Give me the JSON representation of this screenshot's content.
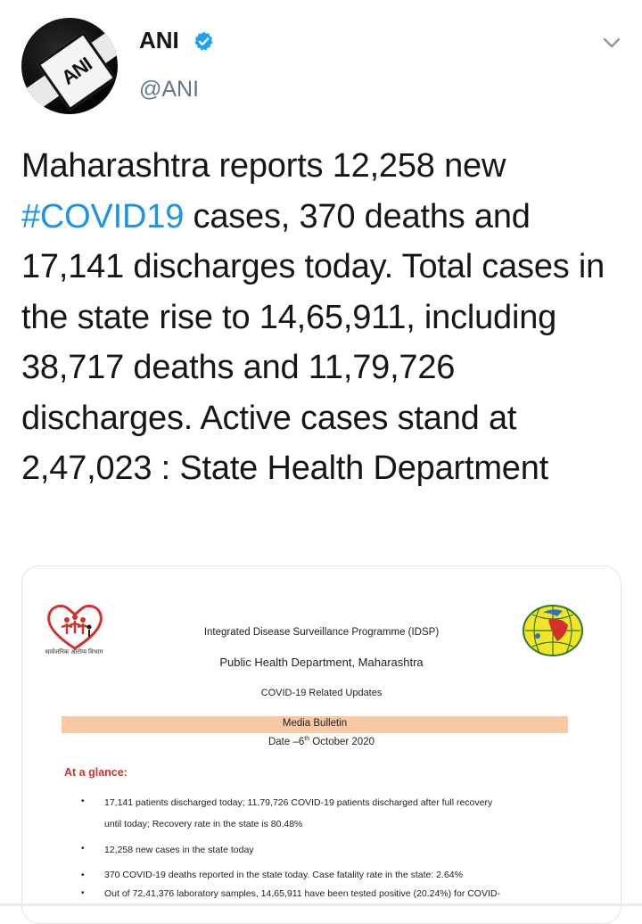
{
  "tweet": {
    "display_name": "ANI",
    "handle": "@ANI",
    "avatar_text": "ANI",
    "text_before_hashtag": "Maharashtra reports 12,258 new ",
    "hashtag": "#COVID19",
    "text_after_hashtag": " cases, 370 deaths and 17,141 discharges today. Total cases in the state rise to 14,65,911, including 38,717 deaths and 11,79,726 discharges. Active cases stand at 2,47,023 : State Health Department"
  },
  "icons": {
    "verified": "verified-badge-icon",
    "menu": "chevron-down-icon"
  },
  "colors": {
    "hashtag": "#1b95e0",
    "verified": "#1da1f2",
    "handle": "#657786",
    "bulletin_bar": "#f8c9a4",
    "at_a_glance": "#d2302c"
  },
  "document": {
    "line1": "Integrated Disease Surveillance Programme (IDSP)",
    "line2": "Public Health Department, Maharashtra",
    "line3": "COVID-19 Related Updates",
    "bulletin": "Media Bulletin",
    "date_prefix": "Date –6",
    "date_sup": "th",
    "date_suffix": " October 2020",
    "left_logo_caption": "सार्वजनिक आरोग्य विभाग",
    "at_a_glance": "At a glance:",
    "bullets": [
      "17,141 patients discharged today; 11,79,726 COVID-19 patients discharged after full recovery",
      "until today; Recovery rate in the state is 80.48%",
      "12,258 new cases in the state today",
      "370 COVID-19 deaths reported in the state today. Case fatality rate in the state: 2.64%",
      "Out of 72,41,376 laboratory samples, 14,65,911 have been tested positive (20.24%) for COVID-"
    ]
  }
}
